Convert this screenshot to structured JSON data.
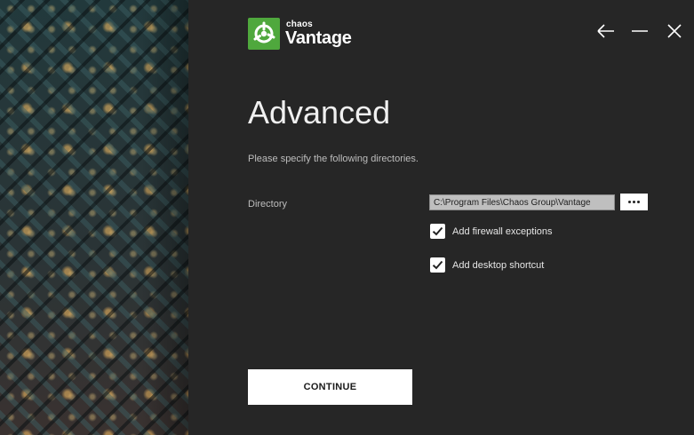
{
  "brand": {
    "company": "chaos",
    "product": "Vantage",
    "accent": "#4fa83d"
  },
  "window_controls": {
    "back_icon": "arrow-left-icon",
    "minimize_icon": "minimize-icon",
    "close_icon": "close-icon"
  },
  "page": {
    "title": "Advanced",
    "subtitle": "Please specify the following directories."
  },
  "directory": {
    "label": "Directory",
    "value": "C:\\Program Files\\Chaos Group\\Vantage",
    "browse_icon": "ellipsis-icon"
  },
  "options": {
    "firewall": {
      "label": "Add firewall exceptions",
      "checked": true
    },
    "shortcut": {
      "label": "Add desktop shortcut",
      "checked": true
    }
  },
  "actions": {
    "continue_label": "CONTINUE"
  }
}
